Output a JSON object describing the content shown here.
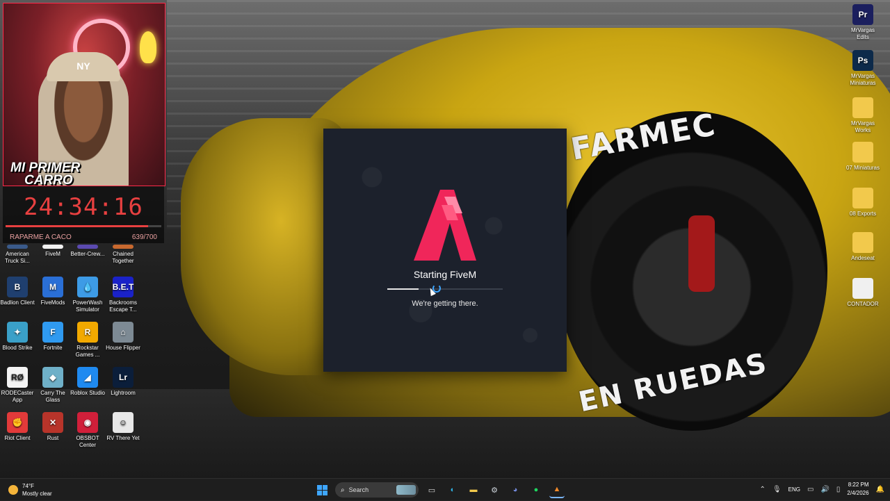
{
  "stream_overlay": {
    "caption_line1": "MI PRIMER",
    "caption_line2": "CARRO",
    "hat_logo": "NY",
    "timer": "24:34:16",
    "goal_label": "RAPARME A CACO",
    "goal_count": "639/700",
    "goal_progress": 0.913
  },
  "wallpaper": {
    "text_top": "FARMEC",
    "text_bottom": "EN RUEDAS"
  },
  "desktop_left": [
    {
      "label": "American Truck Si...",
      "icon": "truck-icon",
      "color": "#3a5a8a",
      "partial": true
    },
    {
      "label": "FiveM",
      "icon": "fivem-icon",
      "color": "#f2f2f2",
      "partial": true
    },
    {
      "label": "Better-Crew...",
      "icon": "crew-icon",
      "color": "#5b4ab0",
      "partial": true
    },
    {
      "label": "Chained Together",
      "icon": "chain-icon",
      "color": "#c8692f",
      "partial": true
    },
    {
      "label": "Badlion Client",
      "icon": "badlion-icon",
      "color": "#1f3f6f",
      "glyph": "B"
    },
    {
      "label": "FiveMods",
      "icon": "fivemods-icon",
      "color": "#2a6fd6",
      "glyph": "M"
    },
    {
      "label": "PowerWash Simulator",
      "icon": "powerwash-icon",
      "color": "#3d9be6",
      "glyph": "💧"
    },
    {
      "label": "Backrooms Escape T...",
      "icon": "backrooms-icon",
      "color": "#1a22c8",
      "glyph": "B.E.T"
    },
    {
      "label": "Blood Strike",
      "icon": "bloodstrike-icon",
      "color": "#3aa0c8",
      "glyph": "✦"
    },
    {
      "label": "Fortnite",
      "icon": "fortnite-icon",
      "color": "#2f9af0",
      "glyph": "F"
    },
    {
      "label": "Rockstar Games ...",
      "icon": "rockstar-icon",
      "color": "#f2a900",
      "glyph": "R"
    },
    {
      "label": "House Flipper",
      "icon": "houseflipper-icon",
      "color": "#7d8a94",
      "glyph": "⌂"
    },
    {
      "label": "RODECaster App",
      "icon": "rodecaster-icon",
      "color": "#f4f4f4",
      "glyph": "RØ"
    },
    {
      "label": "Carry The Glass",
      "icon": "carryglass-icon",
      "color": "#6fb0c8",
      "glyph": "◆"
    },
    {
      "label": "Roblox Studio",
      "icon": "roblox-icon",
      "color": "#1f8af0",
      "glyph": "◢"
    },
    {
      "label": "Lightroom",
      "icon": "lightroom-icon",
      "color": "#0b1e3a",
      "glyph": "Lr"
    },
    {
      "label": "Riot Client",
      "icon": "riot-icon",
      "color": "#e23a3a",
      "glyph": "✊"
    },
    {
      "label": "Rust",
      "icon": "rust-icon",
      "color": "#b8342a",
      "glyph": "✕"
    },
    {
      "label": "OBSBOT Center",
      "icon": "obsbot-icon",
      "color": "#d11f3a",
      "glyph": "◉"
    },
    {
      "label": "RV There Yet",
      "icon": "rvthereyet-icon",
      "color": "#e8e8e8",
      "glyph": "☺"
    }
  ],
  "desktop_right": [
    {
      "label": "MrVargas Edits",
      "icon": "premiere-icon",
      "color": "#1b1f5e",
      "glyph": "Pr"
    },
    {
      "label": "MrVargas Miniaturas",
      "icon": "photoshop-icon",
      "color": "#0d2a4a",
      "glyph": "Ps"
    },
    {
      "label": "MrVargas Works",
      "icon": "folder-icon",
      "color": "#f2c94c",
      "glyph": ""
    },
    {
      "label": "07 Miniaturas",
      "icon": "folder-icon",
      "color": "#f2c94c",
      "glyph": ""
    },
    {
      "label": "08 Exports",
      "icon": "folder-icon",
      "color": "#f2c94c",
      "glyph": ""
    },
    {
      "label": "Andeseat",
      "icon": "folder-icon",
      "color": "#f2c94c",
      "glyph": ""
    },
    {
      "label": "CONTADOR",
      "icon": "file-icon",
      "color": "#f0f0f0",
      "glyph": ""
    }
  ],
  "launcher": {
    "title": "Starting FiveM",
    "status": "We're getting there.",
    "progress": 0.27,
    "accent": "#f0265a"
  },
  "taskbar": {
    "weather_temp": "74°F",
    "weather_desc": "Mostly clear",
    "search_placeholder": "Search",
    "language": "ENG",
    "time": "8:22 PM",
    "date": "2/4/2026",
    "apps": [
      {
        "name": "taskview-icon",
        "glyph": "▭",
        "color": "#ddd"
      },
      {
        "name": "edge-icon",
        "glyph": "◐",
        "color": "#2fb4e6"
      },
      {
        "name": "file-explorer-icon",
        "glyph": "▬",
        "color": "#f2c94c"
      },
      {
        "name": "steam-alt-icon",
        "glyph": "⚙",
        "color": "#cfd6dd"
      },
      {
        "name": "discord-icon",
        "glyph": "◕",
        "color": "#7289da"
      },
      {
        "name": "spotify-icon",
        "glyph": "●",
        "color": "#1ed760"
      },
      {
        "name": "fivem-taskbar-icon",
        "glyph": "▲",
        "color": "#f28a2a"
      }
    ]
  }
}
